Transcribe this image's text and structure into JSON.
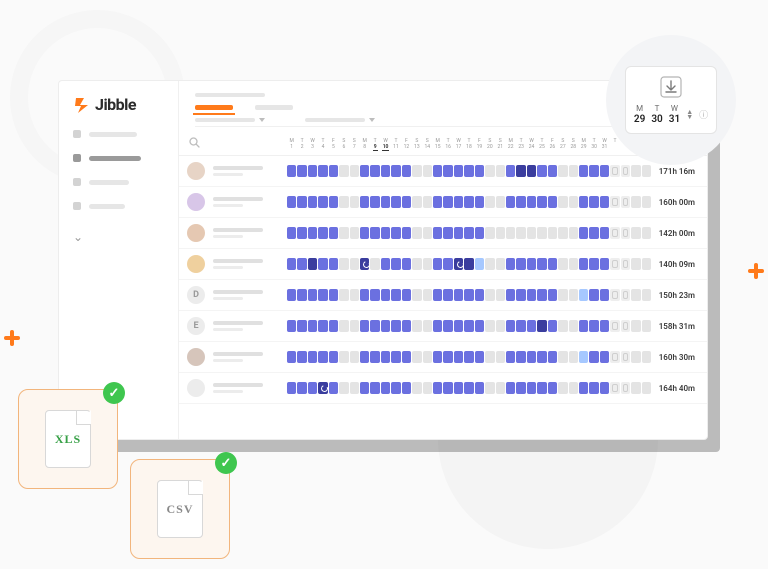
{
  "brand": {
    "name": "Jibble"
  },
  "download": {
    "days": [
      {
        "dow": "M",
        "num": "29"
      },
      {
        "dow": "T",
        "num": "30"
      },
      {
        "dow": "W",
        "num": "31"
      }
    ]
  },
  "files": {
    "xls": "XLS",
    "csv": "CSV"
  },
  "dayHeaders": [
    {
      "dow": "M",
      "n": "1"
    },
    {
      "dow": "T",
      "n": "2"
    },
    {
      "dow": "W",
      "n": "3"
    },
    {
      "dow": "T",
      "n": "4"
    },
    {
      "dow": "F",
      "n": "5"
    },
    {
      "dow": "S",
      "n": "6"
    },
    {
      "dow": "S",
      "n": "7"
    },
    {
      "dow": "M",
      "n": "8"
    },
    {
      "dow": "T",
      "n": "9",
      "sel": true
    },
    {
      "dow": "W",
      "n": "10",
      "sel": true
    },
    {
      "dow": "T",
      "n": "11"
    },
    {
      "dow": "F",
      "n": "12"
    },
    {
      "dow": "S",
      "n": "13"
    },
    {
      "dow": "S",
      "n": "14"
    },
    {
      "dow": "M",
      "n": "15"
    },
    {
      "dow": "T",
      "n": "16"
    },
    {
      "dow": "W",
      "n": "17"
    },
    {
      "dow": "T",
      "n": "18"
    },
    {
      "dow": "F",
      "n": "19"
    },
    {
      "dow": "S",
      "n": "20"
    },
    {
      "dow": "S",
      "n": "21"
    },
    {
      "dow": "M",
      "n": "22"
    },
    {
      "dow": "T",
      "n": "23"
    },
    {
      "dow": "W",
      "n": "24"
    },
    {
      "dow": "T",
      "n": "25"
    },
    {
      "dow": "F",
      "n": "26"
    },
    {
      "dow": "S",
      "n": "27"
    },
    {
      "dow": "S",
      "n": "28"
    },
    {
      "dow": "M",
      "n": "29"
    },
    {
      "dow": "T",
      "n": "30"
    },
    {
      "dow": "W",
      "n": "31"
    },
    {
      "dow": "T",
      "n": ""
    },
    {
      "dow": "F",
      "n": ""
    },
    {
      "dow": "S",
      "n": ""
    },
    {
      "dow": "S",
      "n": ""
    }
  ],
  "rows": [
    {
      "avatarBg": "#e7d4c6",
      "initial": "",
      "total": "171h 16m",
      "cells": [
        "c1",
        "c1",
        "c1",
        "c1",
        "c1",
        "c0",
        "c0",
        "c1",
        "c1",
        "c1",
        "c1",
        "c1",
        "c0",
        "c0",
        "c1",
        "c1",
        "c1",
        "c1",
        "c1",
        "c0",
        "c0",
        "c1",
        "c2",
        "c2",
        "c1",
        "c1",
        "c0",
        "c0",
        "c1",
        "c1",
        "c1",
        "cb",
        "cb",
        "c0",
        "c0"
      ]
    },
    {
      "avatarBg": "#d8c6e8",
      "initial": "",
      "total": "160h 00m",
      "cells": [
        "c1",
        "c1",
        "c1",
        "c1",
        "c1",
        "c0",
        "c0",
        "c1",
        "c1",
        "c1",
        "c1",
        "c1",
        "c0",
        "c0",
        "c1",
        "c1",
        "c1",
        "c1",
        "c1",
        "c0",
        "c0",
        "c1",
        "c1",
        "c1",
        "c1",
        "c1",
        "c0",
        "c0",
        "c1",
        "c1",
        "c1",
        "cb",
        "cb",
        "c0",
        "c0"
      ]
    },
    {
      "avatarBg": "#e5c8b2",
      "initial": "",
      "total": "142h 00m",
      "cells": [
        "c1",
        "c1",
        "c1",
        "c1",
        "c1",
        "c0",
        "c0",
        "c1",
        "c1",
        "c1",
        "c1",
        "c1",
        "c0",
        "c0",
        "c1",
        "c1",
        "c1",
        "c1",
        "c1",
        "c0",
        "c0",
        "c0",
        "c0",
        "c0",
        "c0",
        "c0",
        "c0",
        "c0",
        "c1",
        "c1",
        "c1",
        "cb",
        "cb",
        "c0",
        "c0"
      ]
    },
    {
      "avatarBg": "#efd09e",
      "initial": "",
      "total": "140h 09m",
      "cells": [
        "c1",
        "c1",
        "c2",
        "c1",
        "c1",
        "c0",
        "c0",
        "ci",
        "c0",
        "c1",
        "c1",
        "c1",
        "c0",
        "c0",
        "c1",
        "c1",
        "ci",
        "c2",
        "c3",
        "c0",
        "c0",
        "c1",
        "c1",
        "c1",
        "c1",
        "c1",
        "c0",
        "c0",
        "c1",
        "c1",
        "c1",
        "cb",
        "cb",
        "c0",
        "c0"
      ]
    },
    {
      "avatarBg": "#ececec",
      "initial": "D",
      "total": "150h 23m",
      "cells": [
        "c1",
        "c1",
        "c1",
        "c1",
        "c1",
        "c0",
        "c0",
        "c1",
        "c1",
        "c1",
        "c1",
        "c1",
        "c0",
        "c0",
        "c1",
        "c1",
        "c1",
        "c1",
        "c1",
        "c0",
        "c0",
        "c1",
        "c1",
        "c1",
        "c1",
        "c1",
        "c0",
        "c0",
        "c3",
        "c1",
        "c1",
        "cb",
        "cb",
        "c0",
        "c0"
      ]
    },
    {
      "avatarBg": "#ececec",
      "initial": "E",
      "total": "158h 31m",
      "cells": [
        "c1",
        "c1",
        "c1",
        "c1",
        "c1",
        "c0",
        "c0",
        "c1",
        "c1",
        "c1",
        "c1",
        "c1",
        "c0",
        "c0",
        "c1",
        "c1",
        "c1",
        "c1",
        "c1",
        "c0",
        "c0",
        "c1",
        "c1",
        "c1",
        "c2",
        "c1",
        "c0",
        "c0",
        "c1",
        "c1",
        "c1",
        "cb",
        "cb",
        "c0",
        "c0"
      ]
    },
    {
      "avatarBg": "#d6c5bb",
      "initial": "",
      "total": "160h 30m",
      "cells": [
        "c1",
        "c1",
        "c1",
        "c1",
        "c1",
        "c0",
        "c0",
        "c1",
        "c1",
        "c1",
        "c1",
        "c1",
        "c0",
        "c0",
        "c1",
        "c1",
        "c1",
        "c1",
        "c1",
        "c0",
        "c0",
        "c1",
        "c1",
        "c1",
        "c1",
        "c1",
        "c0",
        "c0",
        "c3",
        "c1",
        "c1",
        "cb",
        "cb",
        "c0",
        "c0"
      ]
    },
    {
      "avatarBg": "#ececec",
      "initial": "",
      "total": "164h 40m",
      "cells": [
        "c1",
        "c1",
        "c1",
        "ci",
        "c1",
        "c0",
        "c0",
        "c1",
        "c1",
        "c1",
        "c1",
        "c1",
        "c0",
        "c0",
        "c1",
        "c1",
        "c1",
        "c1",
        "c1",
        "c0",
        "c0",
        "c1",
        "c1",
        "c1",
        "c1",
        "c1",
        "c0",
        "c0",
        "c1",
        "c1",
        "c1",
        "cb",
        "cb",
        "c0",
        "c0"
      ]
    }
  ]
}
